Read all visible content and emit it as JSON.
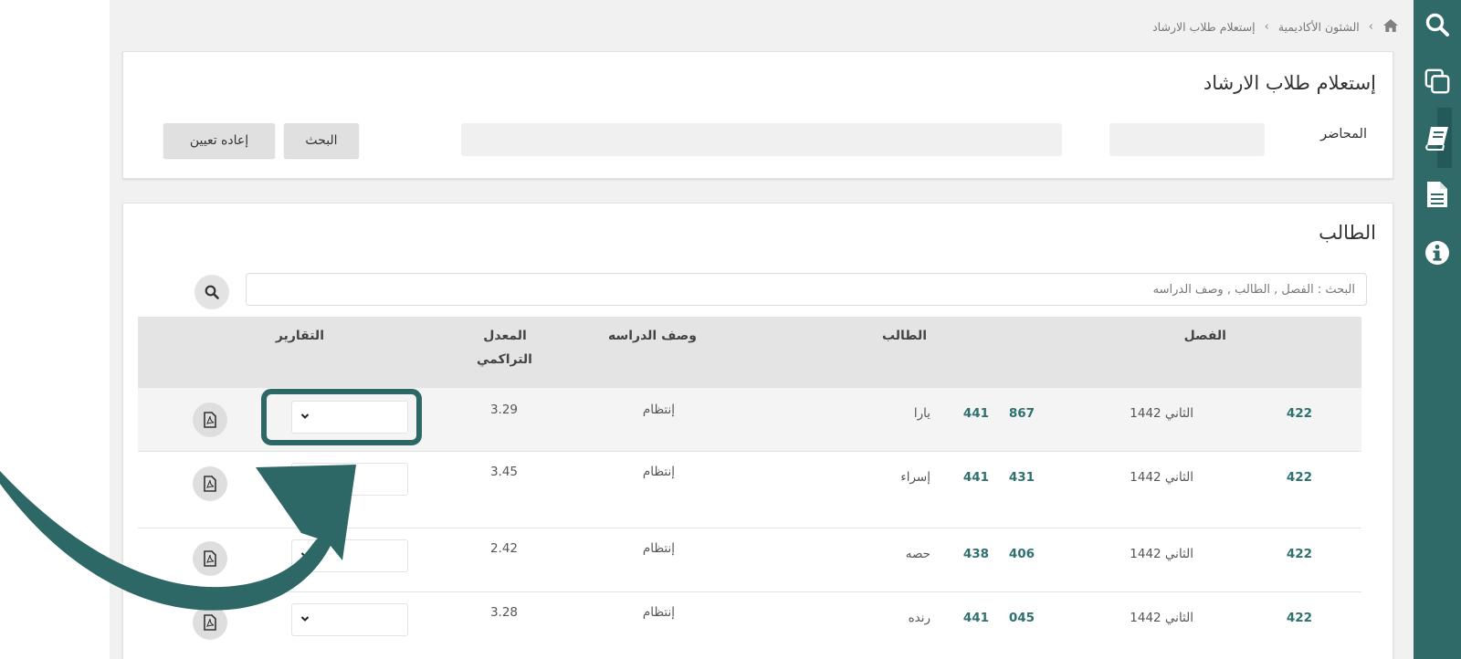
{
  "breadcrumb": {
    "items": [
      "الشئون الأكاديمية",
      "إستعلام طلاب الارشاد"
    ],
    "separator": "›"
  },
  "filter_panel": {
    "title": "إستعلام طلاب الارشاد",
    "lecturer_label": "المحاضر",
    "search_button": "البحث",
    "reset_button": "إعاده تعيين"
  },
  "students_panel": {
    "title": "الطالب",
    "search_placeholder": "البحث : الفصل , الطالب , وصف الدراسه",
    "columns": {
      "semester": "الفصل",
      "student": "الطالب",
      "study_desc": "وصف الدراسه",
      "gpa_line1": "المعدل",
      "gpa_line2": "التراكمي",
      "reports": "التقارير"
    },
    "rows": [
      {
        "code": "422",
        "semester": "الثاني 1442",
        "id1": "867",
        "id2": "441",
        "name": "يارا",
        "study": "إنتظام",
        "gpa": "3.29"
      },
      {
        "code": "422",
        "semester": "الثاني 1442",
        "id1": "431",
        "id2": "441",
        "name": "إسراء",
        "study": "إنتظام",
        "gpa": "3.45"
      },
      {
        "code": "422",
        "semester": "الثاني 1442",
        "id1": "406",
        "id2": "438",
        "name": "حصه",
        "study": "إنتظام",
        "gpa": "2.42"
      },
      {
        "code": "422",
        "semester": "الثاني 1442",
        "id1": "045",
        "id2": "441",
        "name": "رنده",
        "study": "إنتظام",
        "gpa": "3.28"
      }
    ]
  },
  "sidebar": {
    "icons": [
      "search-icon",
      "copy-windows-icon",
      "book-icon",
      "document-icon",
      "info-icon"
    ]
  },
  "colors": {
    "sidebar": "#2f6968",
    "accent": "#2e7170",
    "annotation": "#2d6766"
  }
}
